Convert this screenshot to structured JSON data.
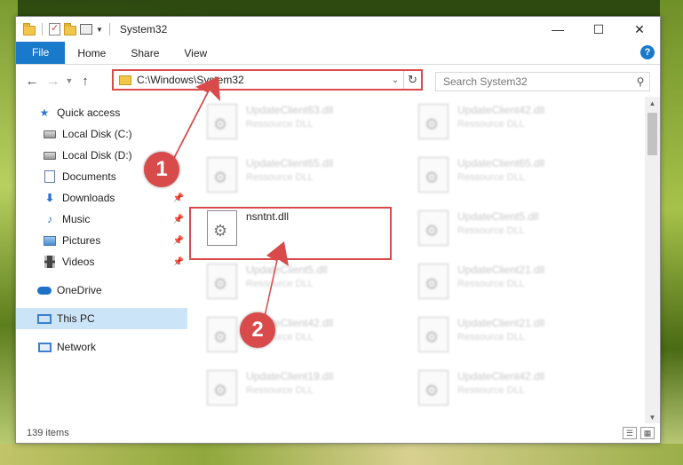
{
  "window": {
    "title": "System32",
    "controls": {
      "minimize": "—",
      "maximize": "☐",
      "close": "✕"
    }
  },
  "ribbon": {
    "tabs": [
      "File",
      "Home",
      "Share",
      "View"
    ],
    "help": "?"
  },
  "address": {
    "path": "C:\\Windows\\System32",
    "search_placeholder": "Search System32"
  },
  "nav": {
    "items": [
      {
        "label": "Quick access",
        "icon": "star-icon"
      },
      {
        "label": "Local Disk (C:)",
        "icon": "drive-icon"
      },
      {
        "label": "Local Disk (D:)",
        "icon": "drive-icon"
      },
      {
        "label": "Documents",
        "icon": "document-icon"
      },
      {
        "label": "Downloads",
        "icon": "download-icon"
      },
      {
        "label": "Music",
        "icon": "music-icon"
      },
      {
        "label": "Pictures",
        "icon": "pictures-icon"
      },
      {
        "label": "Videos",
        "icon": "video-icon"
      },
      {
        "label": "OneDrive",
        "icon": "cloud-icon"
      },
      {
        "label": "This PC",
        "icon": "computer-icon"
      },
      {
        "label": "Network",
        "icon": "network-icon"
      }
    ]
  },
  "files": [
    {
      "name": "UpdateClient63.dll",
      "type": "Ressource DLL"
    },
    {
      "name": "UpdateClient42.dll",
      "type": "Ressource DLL"
    },
    {
      "name": "UpdateClient65.dll",
      "type": "Ressource DLL"
    },
    {
      "name": "UpdateClient65.dll",
      "type": "Ressource DLL"
    },
    {
      "name": "nsntnt.dll",
      "type": ""
    },
    {
      "name": "UpdateClient5.dll",
      "type": "Ressource DLL"
    },
    {
      "name": "UpdateClient5.dll",
      "type": "Ressource DLL"
    },
    {
      "name": "UpdateClient21.dll",
      "type": "Ressource DLL"
    },
    {
      "name": "UpdateClient42.dll",
      "type": "Ressource DLL"
    },
    {
      "name": "UpdateClient21.dll",
      "type": "Ressource DLL"
    },
    {
      "name": "UpdateClient19.dll",
      "type": "Ressource DLL"
    },
    {
      "name": "UpdateClient42.dll",
      "type": "Ressource DLL"
    }
  ],
  "status": {
    "count": "139 items"
  },
  "callouts": {
    "one": "1",
    "two": "2",
    "color": "#d94a4a"
  }
}
